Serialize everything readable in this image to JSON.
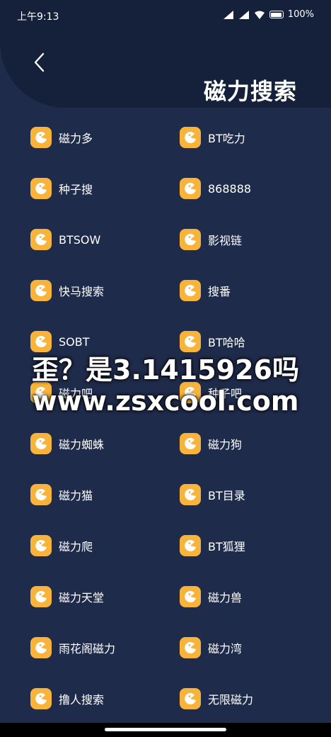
{
  "status_bar": {
    "time": "上午9:13",
    "battery": "100%"
  },
  "header": {
    "title": "磁力搜索"
  },
  "items": [
    {
      "label": "磁力多"
    },
    {
      "label": "BT吃力"
    },
    {
      "label": "种子搜"
    },
    {
      "label": "868888"
    },
    {
      "label": "BTSOW"
    },
    {
      "label": "影视链"
    },
    {
      "label": "快马搜索"
    },
    {
      "label": "搜番"
    },
    {
      "label": "SOBT"
    },
    {
      "label": "BT哈哈"
    },
    {
      "label": "磁力吧"
    },
    {
      "label": "种子吧"
    },
    {
      "label": "磁力蜘蛛"
    },
    {
      "label": "磁力狗"
    },
    {
      "label": "磁力猫"
    },
    {
      "label": "BT目录"
    },
    {
      "label": "磁力爬"
    },
    {
      "label": "BT狐狸"
    },
    {
      "label": "磁力天堂"
    },
    {
      "label": "磁力兽"
    },
    {
      "label": "雨花阁磁力"
    },
    {
      "label": "磁力湾"
    },
    {
      "label": "撸人搜索"
    },
    {
      "label": "无限磁力"
    }
  ],
  "icon_name": "pacman-icon",
  "colors": {
    "background": "#1f2b4a",
    "header": "#15203a",
    "icon": "#f8b43a"
  },
  "watermark": {
    "line1": "歪？是3.1415926吗",
    "line2": "www.zsxcool.com"
  }
}
